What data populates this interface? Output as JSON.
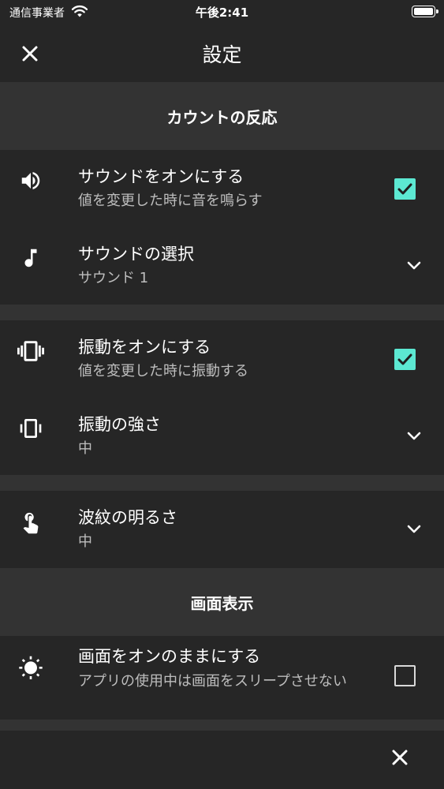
{
  "status_bar": {
    "carrier": "通信事業者",
    "time": "午後2:41"
  },
  "nav": {
    "title": "設定"
  },
  "sections": {
    "count_reaction": "カウントの反応",
    "screen_display": "画面表示"
  },
  "rows": {
    "sound_on": {
      "title": "サウンドをオンにする",
      "subtitle": "値を変更した時に音を鳴らす",
      "checked": true
    },
    "sound_select": {
      "title": "サウンドの選択",
      "value": "サウンド 1"
    },
    "vibration_on": {
      "title": "振動をオンにする",
      "subtitle": "値を変更した時に振動する",
      "checked": true
    },
    "vibration_strength": {
      "title": "振動の強さ",
      "value": "中"
    },
    "ripple_brightness": {
      "title": "波紋の明るさ",
      "value": "中"
    },
    "keep_screen_on": {
      "title": "画面をオンのままにする",
      "subtitle": "アプリの使用中は画面をスリープさせない",
      "checked": false
    }
  },
  "icons": {
    "close": "close-icon",
    "sound": "speaker-icon",
    "music": "music-note-icon",
    "vibration": "vibration-icon",
    "vibration_strength": "phone-vibrate-icon",
    "touch": "touch-hand-icon",
    "brightness": "brightness-icon",
    "chevron": "chevron-down-icon"
  },
  "colors": {
    "accent_checkbox": "#5ce8d2",
    "background": "#262626",
    "section_header": "#333333",
    "subtitle_text": "#bdbdbd"
  }
}
